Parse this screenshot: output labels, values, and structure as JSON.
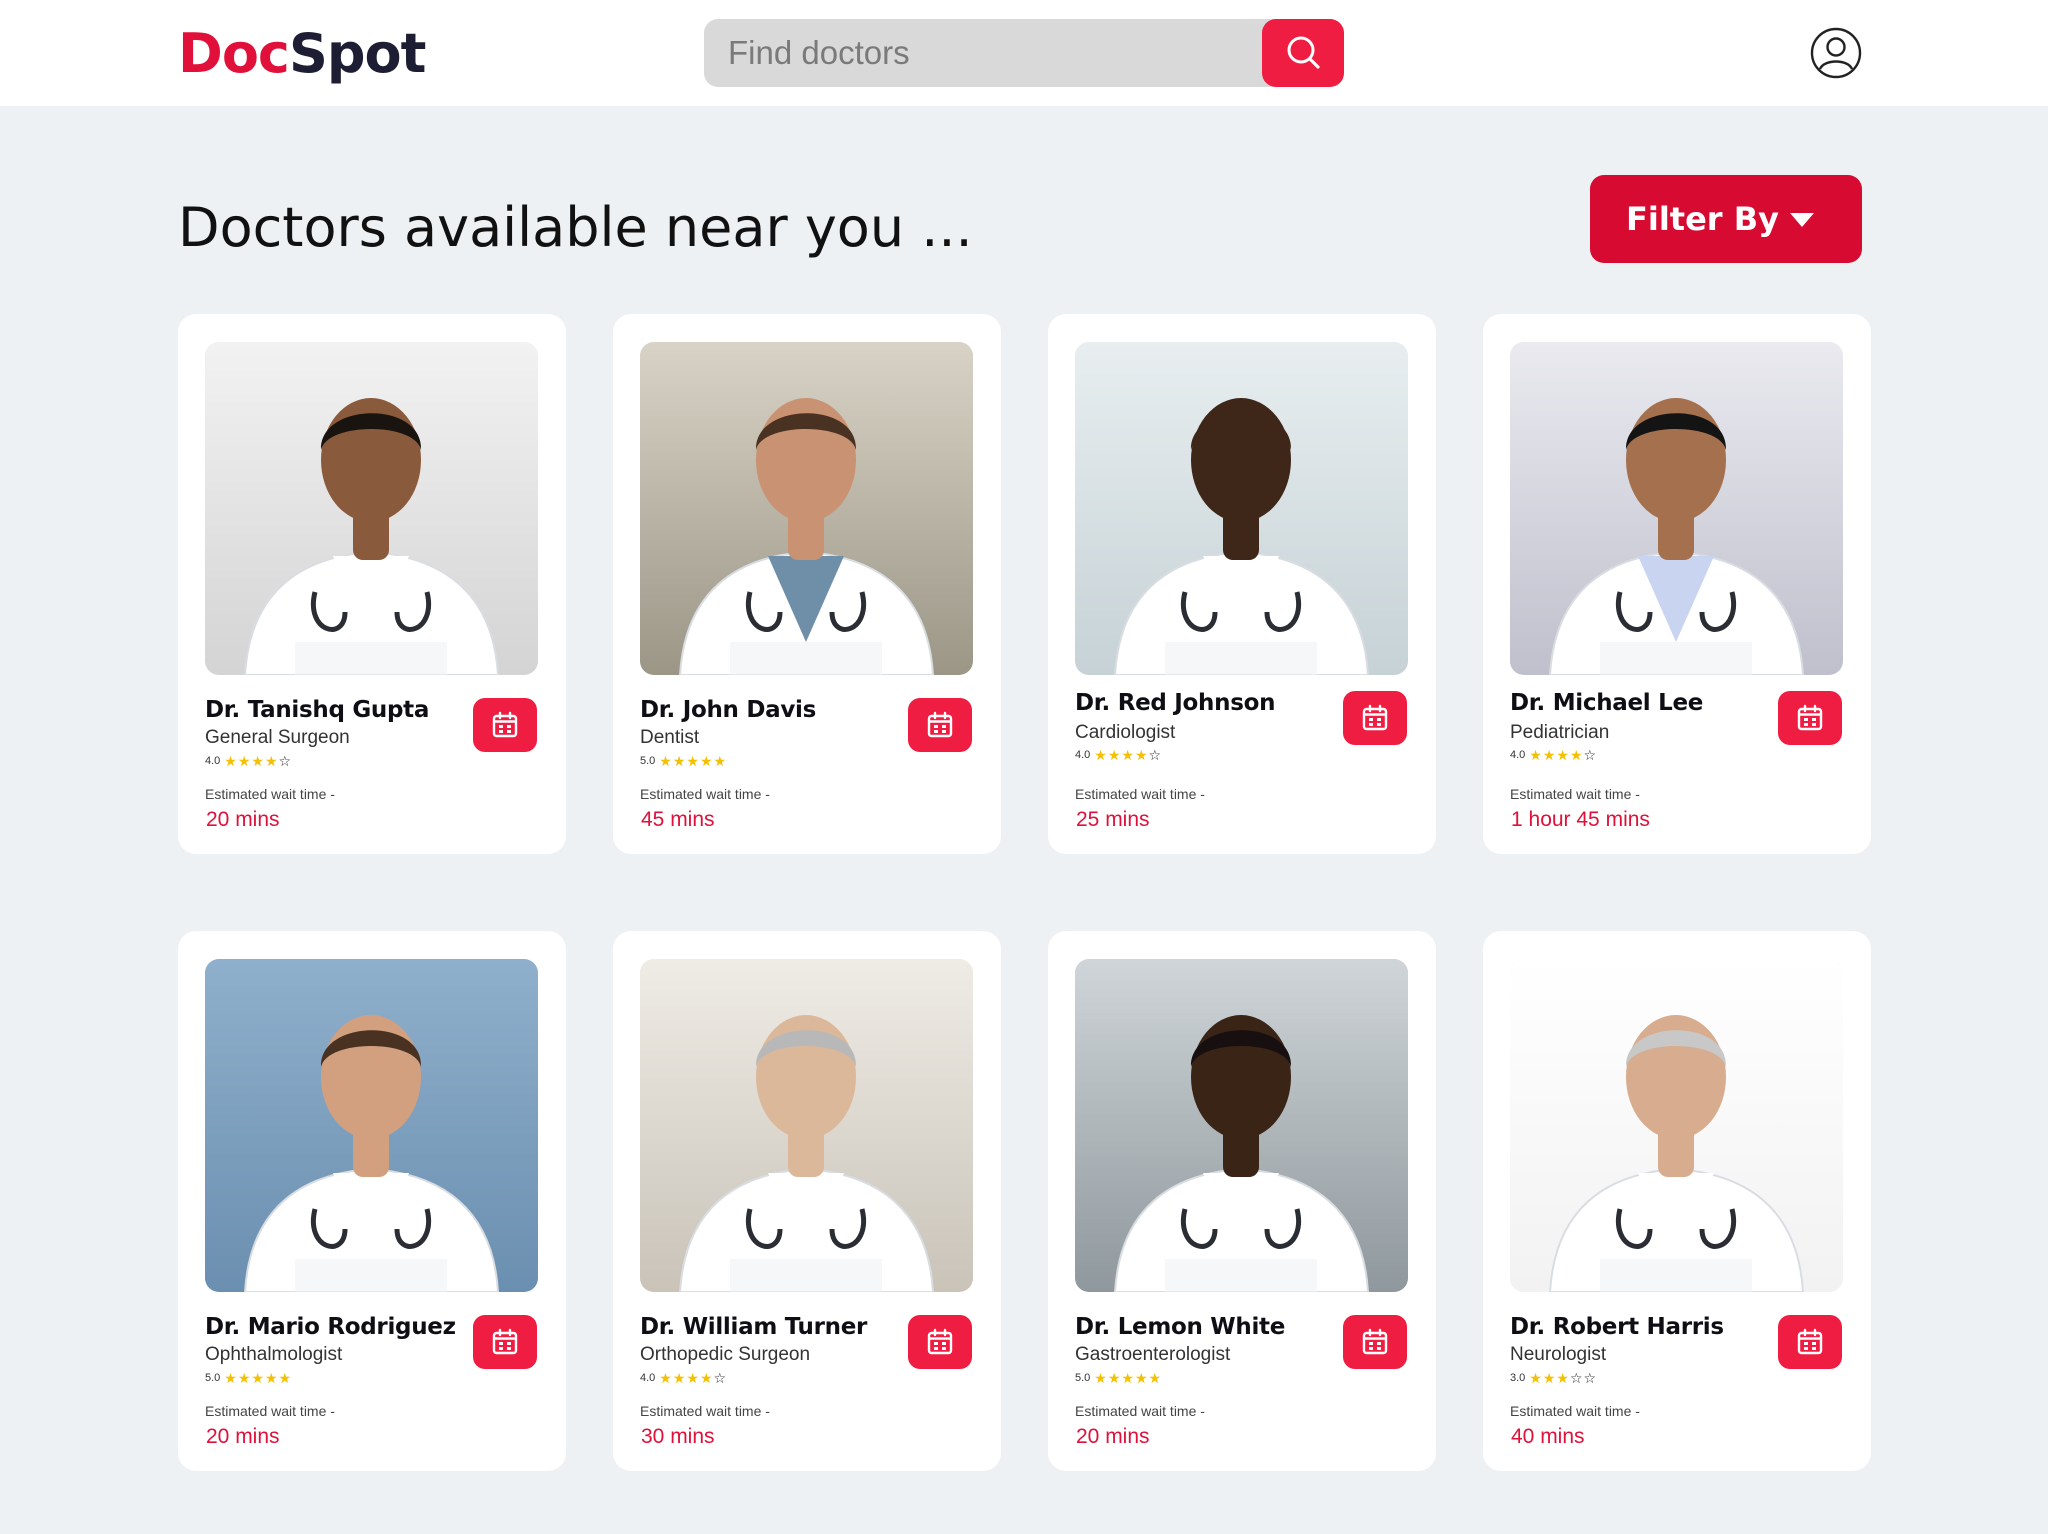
{
  "header": {
    "logo_part1": "Doc",
    "logo_part2": "Spot",
    "search_placeholder": "Find doctors",
    "search_icon": "search-icon",
    "profile_icon": "user-circle-icon"
  },
  "main": {
    "heading": "Doctors available near you ...",
    "filter_label": "Filter By"
  },
  "colors": {
    "brand_red": "#e0103a",
    "button_red": "#ee1d41",
    "filter_red": "#d70a31",
    "star": "#f5c000",
    "background": "#edf1f4"
  },
  "wait_label": "Estimated wait time -",
  "doctors": [
    {
      "name": "Dr. Tanishq Gupta",
      "specialty": "General Surgeon",
      "rating": "4.0",
      "stars": 4,
      "wait": "20 mins"
    },
    {
      "name": "Dr. John Davis",
      "specialty": "Dentist",
      "rating": "5.0",
      "stars": 5,
      "wait": "45 mins"
    },
    {
      "name": "Dr. Red Johnson",
      "specialty": "Cardiologist",
      "rating": "4.0",
      "stars": 4,
      "wait": "25 mins"
    },
    {
      "name": "Dr. Michael Lee",
      "specialty": "Pediatrician",
      "rating": "4.0",
      "stars": 4,
      "wait": "1 hour 45 mins"
    },
    {
      "name": "Dr. Mario Rodriguez",
      "specialty": "Ophthalmologist",
      "rating": "5.0",
      "stars": 5,
      "wait": "20 mins"
    },
    {
      "name": "Dr. William Turner",
      "specialty": "Orthopedic Surgeon",
      "rating": "4.0",
      "stars": 4,
      "wait": "30 mins"
    },
    {
      "name": "Dr. Lemon White",
      "specialty": "Gastroenterologist",
      "rating": "5.0",
      "stars": 5,
      "wait": "20 mins"
    },
    {
      "name": "Dr. Robert Harris",
      "specialty": "Neurologist",
      "rating": "3.0",
      "stars": 3,
      "wait": "40 mins"
    }
  ]
}
